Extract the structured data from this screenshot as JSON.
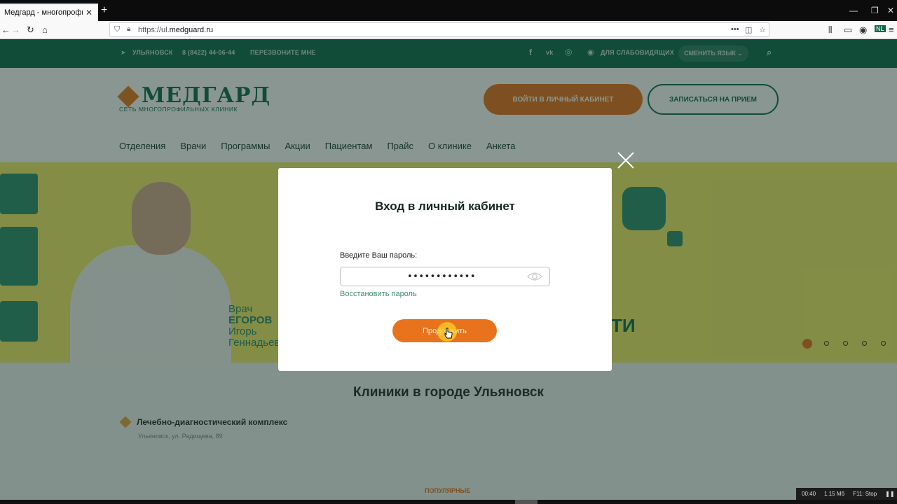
{
  "browser": {
    "tab_title": "Медгард - многопрофильная",
    "tab_close": "✕",
    "new_tab": "+",
    "url_prefix": "https://ul.",
    "url_domain": "medguard.ru",
    "window_controls": [
      "—",
      "❐",
      "✕"
    ]
  },
  "site": {
    "topbar": {
      "city": "УЛЬЯНОВСК",
      "phone": "8 (8422) 44-06-44",
      "callback": "ПЕРЕЗВОНИТЕ МНЕ",
      "accessibility": "ДЛЯ СЛАБОВИДЯЩИХ",
      "language": "СМЕНИТЬ ЯЗЫК ⌄"
    },
    "logo": {
      "name": "МЕДГАРД",
      "subtitle": "СЕТЬ МНОГОПРОФИЛЬНЫХ КЛИНИК"
    },
    "header_buttons": {
      "cabinet": "ВОЙТИ В ЛИЧНЫЙ КАБИНЕТ",
      "appointment": "ЗАПИСАТЬСЯ НА ПРИЕМ"
    },
    "menu": [
      "Отделения",
      "Врачи",
      "Программы",
      "Акции",
      "Пациентам",
      "Прайс",
      "О клинике",
      "Анкета"
    ],
    "banner": {
      "doctor_role": "Врач",
      "doctor_surname": "ЕГОРОВ",
      "doctor_first": "Игорь",
      "doctor_middle": "Геннадьев",
      "headline_fragment": "ТИ",
      "slides": 5,
      "active_slide": 1
    },
    "clinics": {
      "title": "Клиники в городе Ульяновск",
      "items": [
        {
          "name": "Лечебно-диагностический комплекс",
          "address": "Ульяновск, ул. Радищева, 89"
        }
      ]
    },
    "popular": "ПОПУЛЯРНЫЕ"
  },
  "modal": {
    "title": "Вход в личный кабинет",
    "password_label": "Введите Ваш пароль:",
    "password_value": "••••••••••••",
    "restore_link": "Восстановить пароль",
    "continue_button": "Продолжить"
  },
  "recorder": {
    "time": "00:40",
    "size": "1.15 Мб",
    "stop": "F11: Stop",
    "pause": "❚❚"
  },
  "colors": {
    "brand_green": "#0f6a4c",
    "accent_orange": "#e8731c",
    "banner_yellow": "#f3ec66"
  }
}
